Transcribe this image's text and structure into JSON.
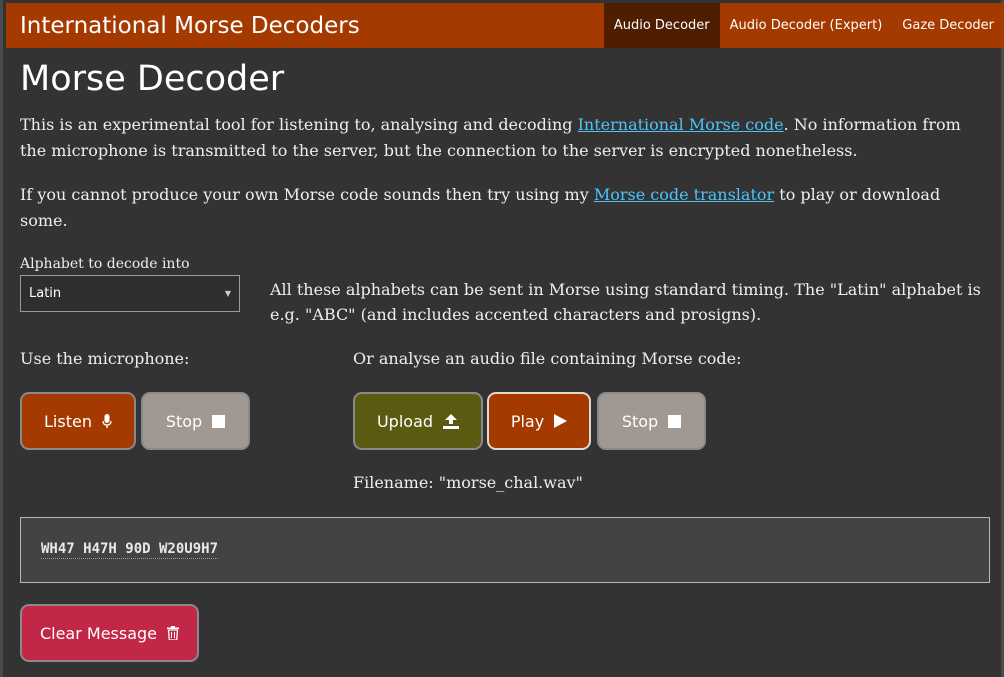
{
  "navbar": {
    "brand": "International Morse Decoders",
    "links": [
      {
        "label": "Audio Decoder",
        "active": true
      },
      {
        "label": "Audio Decoder (Expert)",
        "active": false
      },
      {
        "label": "Gaze Decoder",
        "active": false
      }
    ]
  },
  "page": {
    "title": "Morse Decoder",
    "intro_before_link": "This is an experimental tool for listening to, analysing and decoding ",
    "intro_link": "International Morse code",
    "intro_after_link": ". No information from the microphone is transmitted to the server, but the connection to the server is encrypted nonetheless.",
    "translator_before_link": "If you cannot produce your own Morse code sounds then try using my ",
    "translator_link": "Morse code translator",
    "translator_after_link": " to play or download some."
  },
  "alphabet": {
    "label": "Alphabet to decode into",
    "selected": "Latin",
    "description": "All these alphabets can be sent in Morse using standard timing. The \"Latin\" alphabet is e.g. \"ABC\" (and includes accented characters and prosigns)."
  },
  "microphone": {
    "label": "Use the microphone:",
    "listen_label": "Listen",
    "stop_label": "Stop"
  },
  "audio_file": {
    "label": "Or analyse an audio file containing Morse code:",
    "upload_label": "Upload",
    "play_label": "Play",
    "stop_label": "Stop",
    "filename": "Filename: \"morse_chal.wav\""
  },
  "output": {
    "message": "WH47 H47H 90D W20U9H7"
  },
  "clear": {
    "label": "Clear Message"
  },
  "colors": {
    "navbar": "#a53a00",
    "nav_active": "#4f1d00",
    "background": "#333333",
    "link": "#4fc3f7",
    "listen_button": "#a53a00",
    "stop_button": "#a19891",
    "upload_button": "#5b5a11",
    "play_button": "#a53a00",
    "clear_button": "#c22747"
  },
  "icons": {
    "listen": "microphone-icon",
    "stop": "stop-square-icon",
    "upload": "upload-icon",
    "play": "play-triangle-icon",
    "clear": "trash-icon",
    "select": "chevron-down-icon"
  }
}
